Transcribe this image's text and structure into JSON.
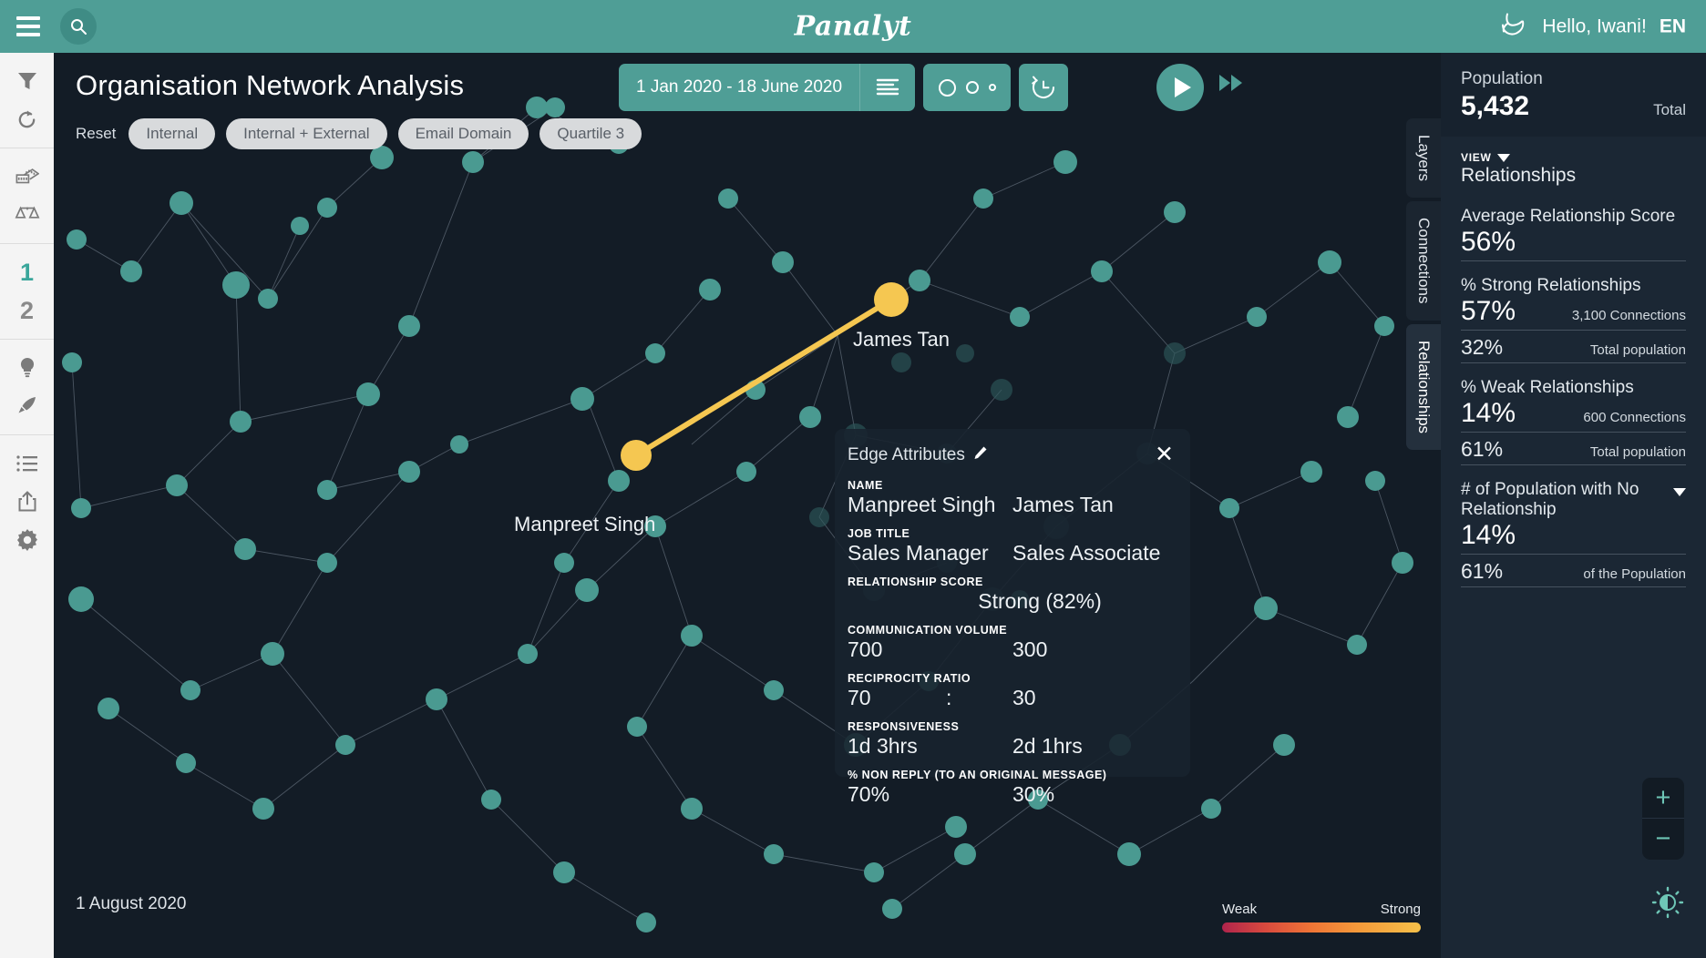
{
  "header": {
    "menu_icon": "hamburger-icon",
    "search_icon": "search-icon",
    "logo": "Panalyt",
    "greeting": "Hello, Iwani!",
    "language": "EN",
    "brand_icon": "swan-logo-icon",
    "accent_color": "#4f9e96"
  },
  "rail": {
    "items": [
      {
        "icon": "filter-icon",
        "label": "Filter"
      },
      {
        "icon": "refresh-icon",
        "label": "Refresh"
      },
      {
        "icon": "ruler-icon",
        "label": "Measure"
      },
      {
        "icon": "scales-icon",
        "label": "Compare"
      },
      {
        "icon": "number-one-icon",
        "label": "1"
      },
      {
        "icon": "number-two-icon",
        "label": "2"
      },
      {
        "icon": "lightbulb-icon",
        "label": "Insights"
      },
      {
        "icon": "rocket-icon",
        "label": "Launch"
      },
      {
        "icon": "list-icon",
        "label": "List"
      },
      {
        "icon": "share-icon",
        "label": "Export"
      },
      {
        "icon": "gear-icon",
        "label": "Settings"
      }
    ],
    "active_label": "1",
    "active_color": "#3aa69b"
  },
  "main": {
    "title": "Organisation Network Analysis",
    "reset_label": "Reset",
    "chips": [
      {
        "label": "Internal"
      },
      {
        "label": "Internal + External"
      },
      {
        "label": "Email Domain"
      },
      {
        "label": "Quartile 3"
      }
    ],
    "date_range": "1 Jan 2020 - 18 June 2020",
    "date_icon": "filter-lines-icon",
    "size_icon": "node-size-icon",
    "history_icon": "history-rewind-icon",
    "play_icon": "play-icon",
    "forward_icon": "fast-forward-icon",
    "canvas_date": "1 August 2020",
    "legend": {
      "weak_label": "Weak",
      "strong_label": "Strong",
      "gradient_from": "#b0244c",
      "gradient_to": "#f6c049"
    },
    "vtabs": [
      {
        "label": "Layers",
        "active": false
      },
      {
        "label": "Connections",
        "active": false
      },
      {
        "label": "Relationships",
        "active": true
      }
    ],
    "node_labels": [
      {
        "name": "Manpreet Singh"
      },
      {
        "name": "James Tan"
      }
    ],
    "node_color": "#4a9a91",
    "highlight_color": "#f5c751",
    "background_color": "#131c26"
  },
  "popup": {
    "title": "Edge Attributes",
    "edit_icon": "pencil-icon",
    "close_icon": "close-icon",
    "rows": [
      {
        "label": "NAME",
        "left": "Manpreet Singh",
        "right": "James Tan"
      },
      {
        "label": "JOB TITLE",
        "left": "Sales Manager",
        "right": "Sales Associate"
      },
      {
        "label": "RELATIONSHIP SCORE",
        "center": "Strong (82%)"
      },
      {
        "label": "COMMUNICATION VOLUME",
        "left": "700",
        "right": "300"
      },
      {
        "label": "RECIPROCITY RATIO",
        "left": "70",
        "separator": ":",
        "right": "30"
      },
      {
        "label": "RESPONSIVENESS",
        "left": "1d 3hrs",
        "right": "2d 1hrs"
      },
      {
        "label": "% NON REPLY (TO AN ORIGINAL MESSAGE)",
        "left": "70%",
        "right": "30%"
      }
    ]
  },
  "right_panel": {
    "population_label": "Population",
    "population_value": "5,432",
    "population_sub": "Total",
    "view_label": "VIEW",
    "view_value": "Relationships",
    "metrics": [
      {
        "label": "Average Relationship Score",
        "value": "56%",
        "note": "",
        "has_second": false
      },
      {
        "label": "% Strong Relationships",
        "value": "57%",
        "note": "3,100 Connections",
        "has_second": true,
        "second_value": "32%",
        "second_note": "Total population"
      },
      {
        "label": "% Weak Relationships",
        "value": "14%",
        "note": "600 Connections",
        "has_second": true,
        "second_value": "61%",
        "second_note": "Total population"
      },
      {
        "label": "# of Population with No Relationship",
        "value": "14%",
        "note": "",
        "has_second": true,
        "second_value": "61%",
        "second_note": "of the Population",
        "has_caret": true
      }
    ],
    "zoom_in": "+",
    "zoom_out": "−",
    "brightness_icon": "brightness-icon"
  }
}
